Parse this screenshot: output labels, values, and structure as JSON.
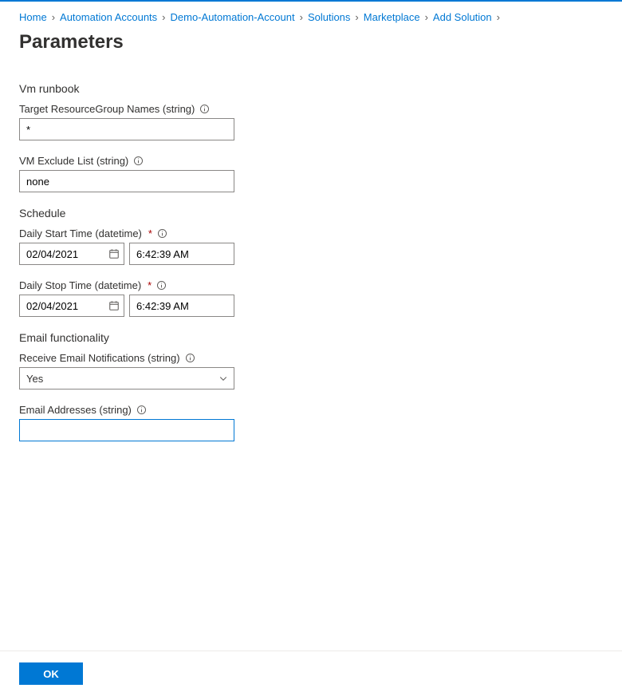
{
  "breadcrumb": {
    "items": [
      {
        "label": "Home"
      },
      {
        "label": "Automation Accounts"
      },
      {
        "label": "Demo-Automation-Account"
      },
      {
        "label": "Solutions"
      },
      {
        "label": "Marketplace"
      },
      {
        "label": "Add Solution"
      }
    ]
  },
  "page_title": "Parameters",
  "sections": {
    "vm_runbook": {
      "title": "Vm runbook",
      "target_rg": {
        "label": "Target ResourceGroup Names (string)",
        "value": "*"
      },
      "exclude_list": {
        "label": "VM Exclude List (string)",
        "value": "none"
      }
    },
    "schedule": {
      "title": "Schedule",
      "start": {
        "label": "Daily Start Time (datetime)",
        "date": "02/04/2021",
        "time": "6:42:39 AM"
      },
      "stop": {
        "label": "Daily Stop Time (datetime)",
        "date": "02/04/2021",
        "time": "6:42:39 AM"
      }
    },
    "email": {
      "title": "Email functionality",
      "receive": {
        "label": "Receive Email Notifications (string)",
        "value": "Yes"
      },
      "addresses": {
        "label": "Email Addresses (string)",
        "value": ""
      }
    }
  },
  "footer": {
    "ok_label": "OK"
  }
}
